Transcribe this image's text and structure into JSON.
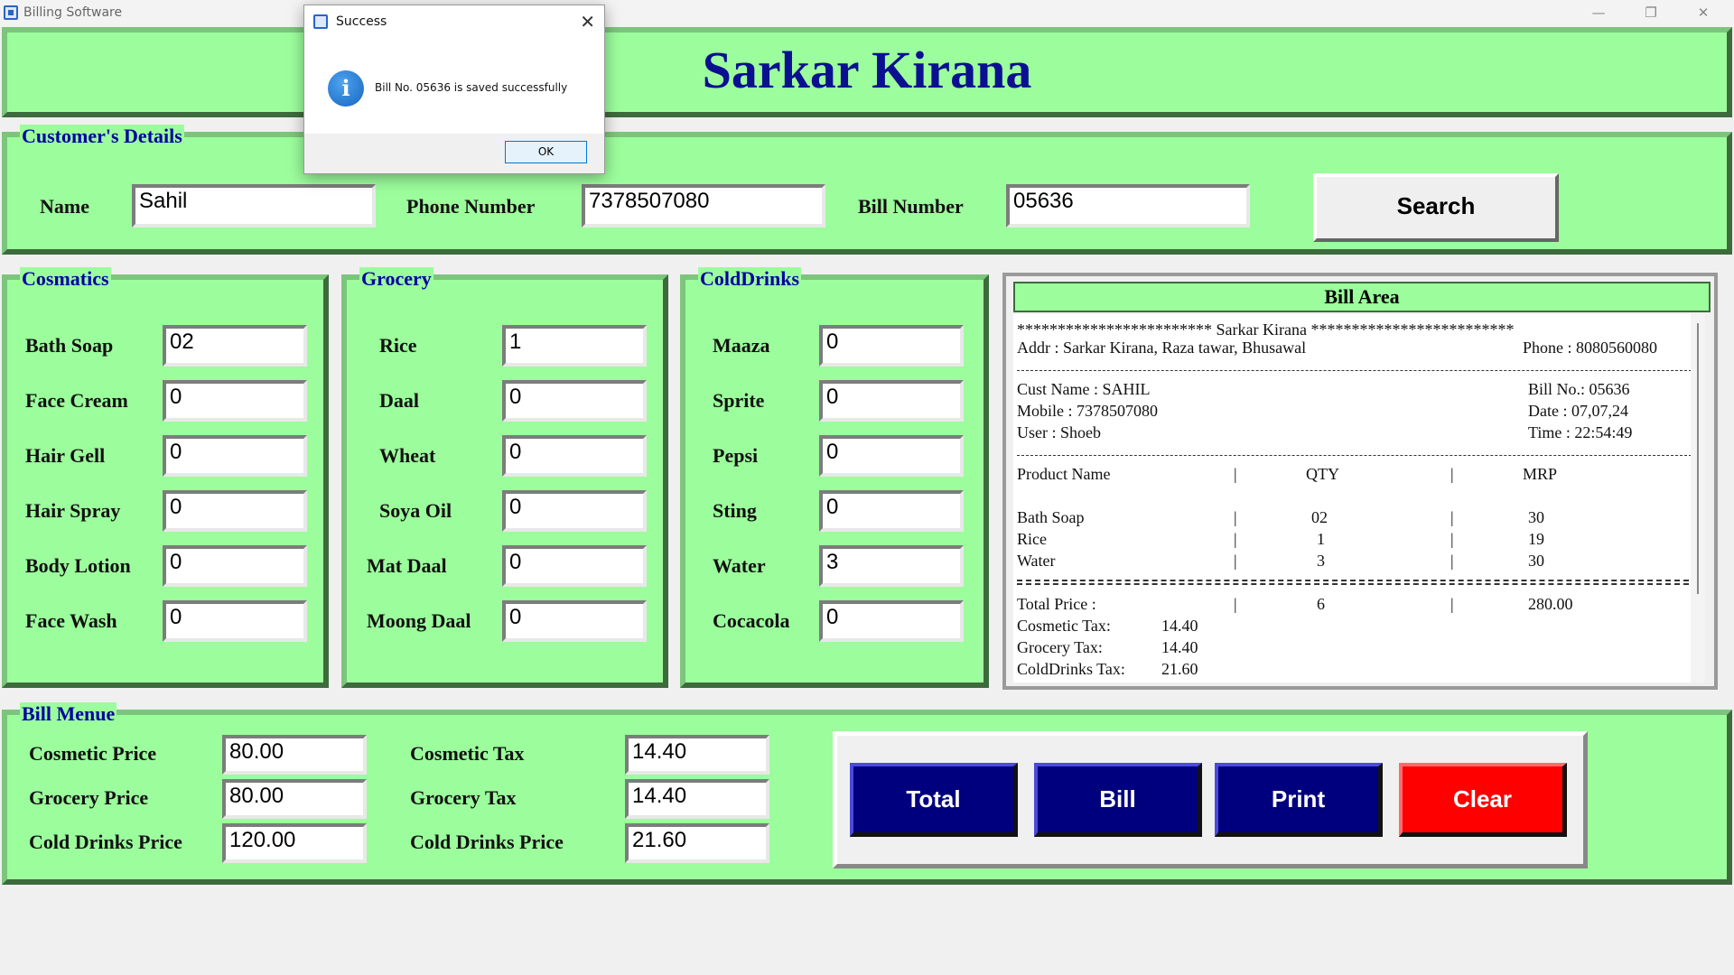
{
  "window": {
    "title": "Billing Software",
    "minimize": "—",
    "restore": "❐",
    "close": "✕"
  },
  "header": {
    "title": "Sarkar Kirana"
  },
  "customer": {
    "section_title": "Customer's Details",
    "name_label": "Name",
    "name_value": "Sahil",
    "phone_label": "Phone Number",
    "phone_value": "7378507080",
    "bill_label": "Bill Number",
    "bill_value": "05636",
    "search_label": "Search"
  },
  "cosmetics": {
    "title": "Cosmatics",
    "items": [
      {
        "label": "Bath Soap",
        "value": "02"
      },
      {
        "label": "Face Cream",
        "value": "0"
      },
      {
        "label": "Hair Gell",
        "value": "0"
      },
      {
        "label": "Hair Spray",
        "value": "0"
      },
      {
        "label": "Body Lotion",
        "value": "0"
      },
      {
        "label": "Face Wash",
        "value": "0"
      }
    ]
  },
  "grocery": {
    "title": "Grocery",
    "items": [
      {
        "label": "Rice",
        "value": "1"
      },
      {
        "label": "Daal",
        "value": "0"
      },
      {
        "label": "Wheat",
        "value": "0"
      },
      {
        "label": "Soya Oil",
        "value": "0"
      },
      {
        "label": "Mat Daal",
        "value": "0"
      },
      {
        "label": "Moong Daal",
        "value": "0"
      }
    ]
  },
  "colddrinks": {
    "title": "ColdDrinks",
    "items": [
      {
        "label": "Maaza",
        "value": "0"
      },
      {
        "label": "Sprite",
        "value": "0"
      },
      {
        "label": "Pepsi",
        "value": "0"
      },
      {
        "label": "Sting",
        "value": "0"
      },
      {
        "label": "Water",
        "value": "3"
      },
      {
        "label": "Cocacola",
        "value": "0"
      }
    ]
  },
  "bill_area": {
    "title": "Bill Area",
    "shop_line": "************************  Sarkar Kirana  *************************",
    "addr": "Addr : Sarkar Kirana, Raza tawar, Bhusawal",
    "phone": "Phone : 8080560080",
    "cust_name": "Cust Name : SAHIL",
    "bill_no": "Bill No.: 05636",
    "mobile": "Mobile : 7378507080",
    "date": "Date : 07,07,24",
    "user": "User : Shoeb",
    "time": "Time : 22:54:49",
    "col_product": "Product Name",
    "col_qty": "QTY",
    "col_mrp": "MRP",
    "divider": "|",
    "items": [
      {
        "name": "Bath Soap",
        "qty": "02",
        "mrp": "30"
      },
      {
        "name": "Rice",
        "qty": "1",
        "mrp": "19"
      },
      {
        "name": "Water",
        "qty": "3",
        "mrp": "30"
      }
    ],
    "total_label": "Total Price :",
    "total_qty": "6",
    "total_mrp": "280.00",
    "taxes": [
      {
        "label": "Cosmetic Tax:",
        "value": "14.40"
      },
      {
        "label": "Grocery Tax:",
        "value": "14.40"
      },
      {
        "label": "ColdDrinks Tax:",
        "value": "21.60"
      }
    ]
  },
  "bill_menu": {
    "title": "Bill Menue",
    "prices": [
      {
        "label": "Cosmetic Price",
        "value": "80.00"
      },
      {
        "label": "Grocery Price",
        "value": "80.00"
      },
      {
        "label": "Cold Drinks Price",
        "value": "120.00"
      }
    ],
    "taxes": [
      {
        "label": "Cosmetic Tax",
        "value": "14.40"
      },
      {
        "label": "Grocery Tax",
        "value": "14.40"
      },
      {
        "label": "Cold Drinks Price",
        "value": "21.60"
      }
    ]
  },
  "actions": {
    "total": "Total",
    "bill": "Bill",
    "print": "Print",
    "clear": "Clear"
  },
  "colors": {
    "panel_green": "#9cfd9c",
    "navy": "#00007f",
    "red": "#ff0000",
    "title_blue": "#0a1090"
  },
  "dialog": {
    "title": "Success",
    "message": "Bill No. 05636 is saved successfully",
    "info_glyph": "i",
    "close_glyph": "✕",
    "ok_label": "OK"
  }
}
